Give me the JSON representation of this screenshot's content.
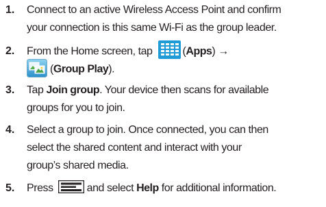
{
  "steps": [
    {
      "number": "1.",
      "lines": [
        "Connect to an active Wireless Access Point and confirm",
        "your connection is this same Wi-Fi as the group leader."
      ]
    },
    {
      "number": "2.",
      "line1_before": "From the Home screen, tap",
      "apps_open": "(",
      "apps_label": "Apps",
      "apps_close": ")",
      "arrow": "→",
      "group_open": "(",
      "group_label": "Group Play",
      "group_close": ")."
    },
    {
      "number": "3.",
      "line1_before": "Tap ",
      "join_label": "Join group",
      "line1_after": ". Your device then scans for available",
      "line2": "groups for you to join."
    },
    {
      "number": "4.",
      "lines": [
        "Select a group to join. Once connected, you can then",
        "select the shared content and interact with your",
        "group’s shared media."
      ]
    },
    {
      "number": "5.",
      "before": "Press",
      "middle": "and select ",
      "help_label": "Help",
      "after": " for additional information."
    }
  ],
  "icons": {
    "apps": "apps-grid-icon",
    "group_play": "group-play-app-icon",
    "menu": "menu-key-icon"
  },
  "colors": {
    "text": "#231f20",
    "apps_icon": "#1f9bd7",
    "watermark": "#e8e8e8"
  }
}
